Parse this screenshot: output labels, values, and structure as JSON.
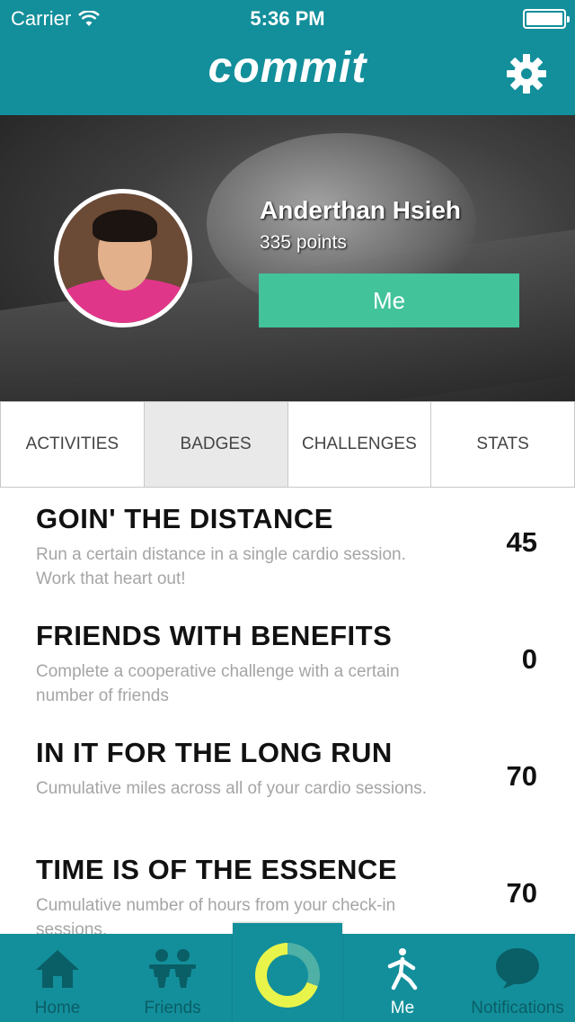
{
  "status_bar": {
    "carrier": "Carrier",
    "time": "5:36 PM"
  },
  "nav": {
    "title": "commit"
  },
  "profile": {
    "name": "Anderthan Hsieh",
    "points": "335 points",
    "button_label": "Me"
  },
  "tabs": [
    {
      "label": "ACTIVITIES",
      "active": false
    },
    {
      "label": "BADGES",
      "active": true
    },
    {
      "label": "CHALLENGES",
      "active": false
    },
    {
      "label": "STATS",
      "active": false
    }
  ],
  "badges": [
    {
      "title": "GOIN' THE DISTANCE",
      "description": "Run a certain distance in a single cardio session. Work that heart out!",
      "value": "45"
    },
    {
      "title": "FRIENDS WITH BENEFITS",
      "description": "Complete a cooperative challenge with a certain number of friends",
      "value": "0"
    },
    {
      "title": "IN IT FOR THE LONG RUN",
      "description": "Cumulative miles across all of your cardio sessions.",
      "value": "70"
    },
    {
      "title": "TIME IS OF THE ESSENCE",
      "description": "Cumulative number of hours from your check-in sessions.",
      "value": "70"
    }
  ],
  "tabbar": {
    "home": "Home",
    "friends": "Friends",
    "me": "Me",
    "notifications": "Notifications"
  },
  "colors": {
    "primary": "#138f9b",
    "accent": "#42c39a",
    "active_tab_bg": "#e9e9e9"
  }
}
